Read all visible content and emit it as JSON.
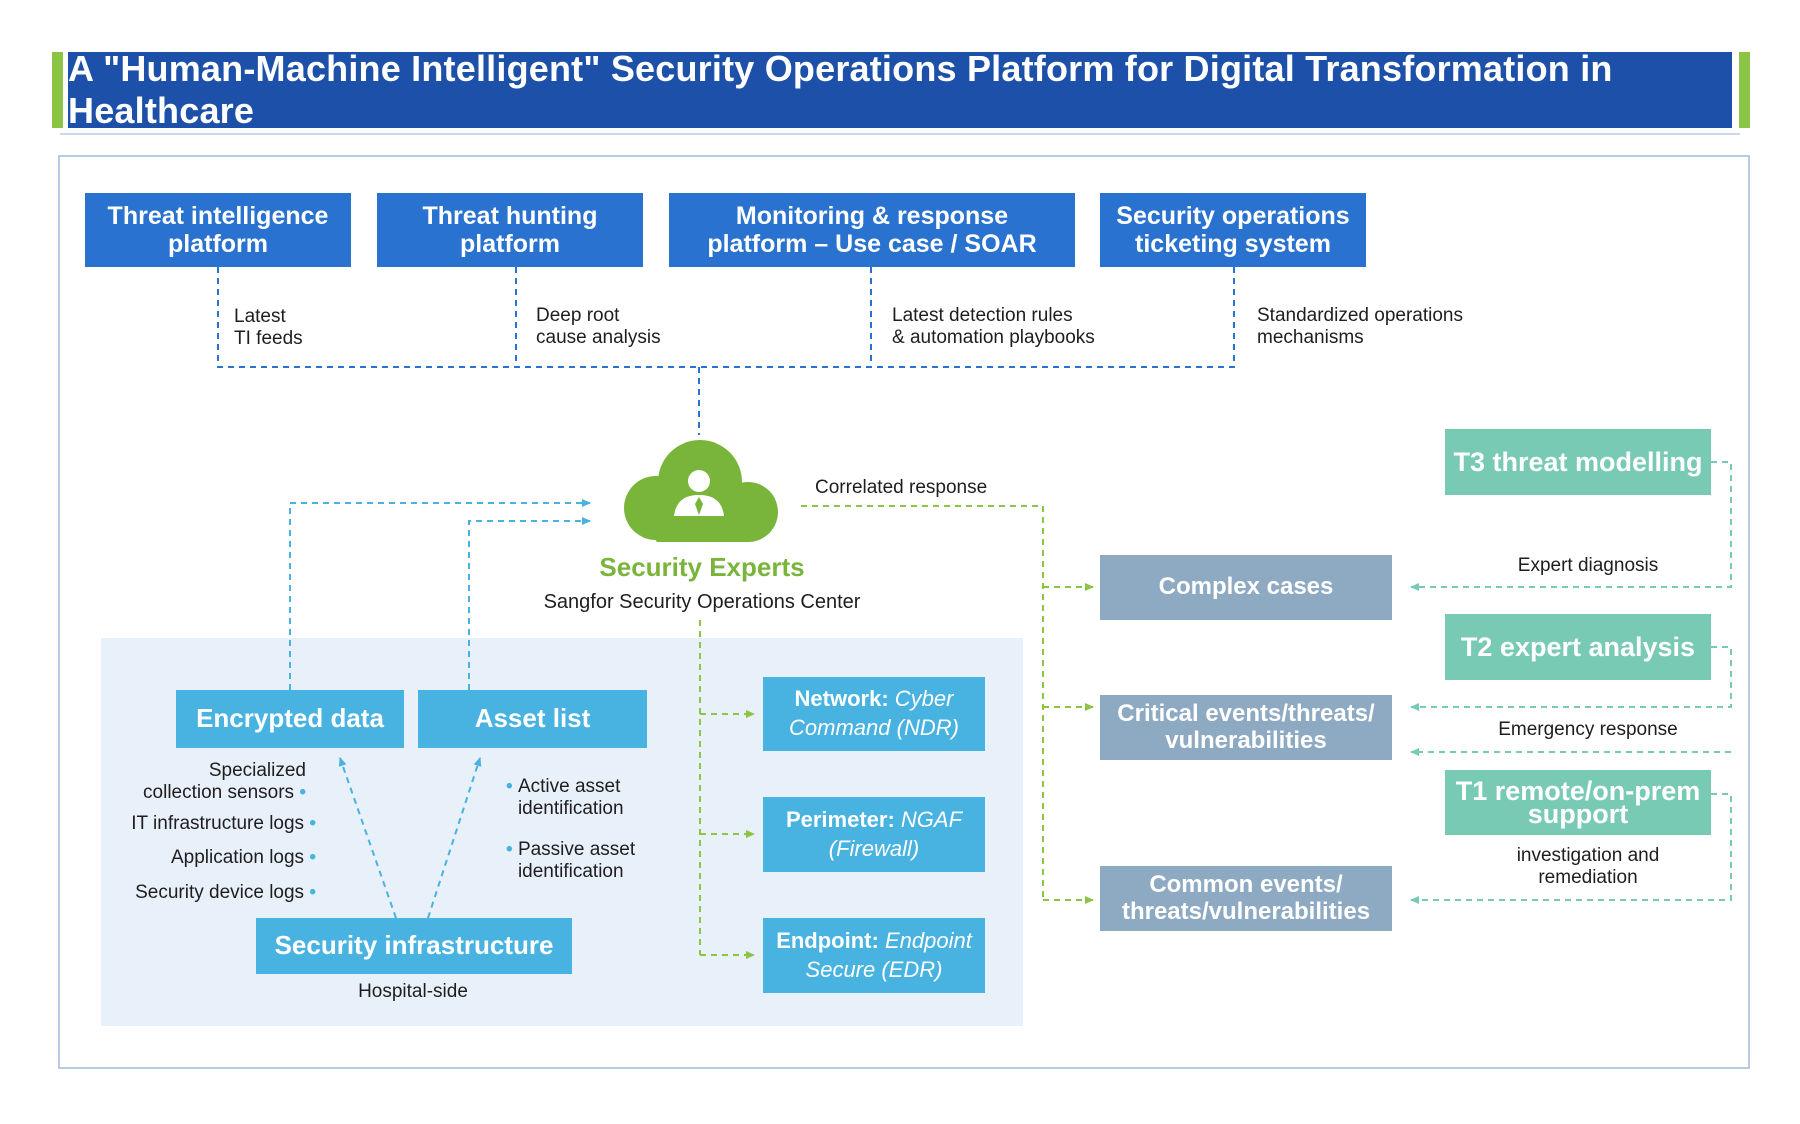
{
  "title": "A \"Human-Machine Intelligent\" Security Operations Platform for Digital Transformation in Healthcare",
  "platforms": [
    {
      "label": "Threat intelligence platform",
      "note": "Latest\nTI feeds"
    },
    {
      "label": "Threat hunting platform",
      "note": "Deep root\ncause analysis"
    },
    {
      "label": "Monitoring & response platform – Use case / SOAR",
      "note": "Latest detection rules\n& automation playbooks"
    },
    {
      "label": "Security operations ticketing system",
      "note": "Standardized operations\nmechanisms"
    }
  ],
  "center": {
    "icon": "cloud-expert-icon",
    "title": "Security Experts",
    "subtitle": "Sangfor Security Operations Center",
    "correlated": "Correlated response"
  },
  "hospital": {
    "encrypted": "Encrypted data",
    "asset_list": "Asset list",
    "infrastructure": "Security infrastructure",
    "infra_caption": "Hospital-side",
    "encrypted_sources": [
      "Specialized\ncollection sensors",
      "IT infrastructure logs",
      "Application logs",
      "Security device logs"
    ],
    "asset_items": [
      "Active asset\nidentification",
      "Passive asset\nidentification"
    ]
  },
  "tools": [
    {
      "label": "Network:",
      "product": "Cyber Command (NDR)"
    },
    {
      "label": "Perimeter:",
      "product": "NGAF (Firewall)"
    },
    {
      "label": "Endpoint:",
      "product": "Endpoint Secure (EDR)"
    }
  ],
  "cases": [
    "Complex cases",
    "Critical events/threats/ vulnerabilities",
    "Common events/ threats/vulnerabilities"
  ],
  "tiers": [
    {
      "label": "T3 threat modelling",
      "note": "Expert diagnosis"
    },
    {
      "label": "T2 expert analysis",
      "note": "Emergency response"
    },
    {
      "label": "T1 remote/on-prem support",
      "note": "investigation and\nremediation"
    }
  ],
  "colors": {
    "title_bg": "#1c50a9",
    "accent_green": "#8cc443",
    "top_box": "#2a72cf",
    "light_blue": "#48b2e0",
    "gray_box": "#8eaac3",
    "teal_box": "#79cab5",
    "expert_green": "#7ab53b"
  }
}
